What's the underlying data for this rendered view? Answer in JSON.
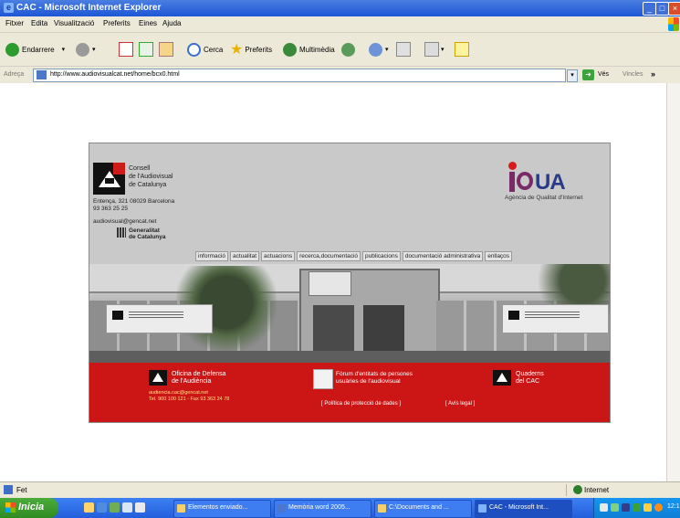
{
  "window": {
    "title": "CAC - Microsoft Internet Explorer",
    "minimize_glyph": "_",
    "maximize_glyph": "□",
    "close_glyph": "×"
  },
  "menu": {
    "items": [
      "Fitxer",
      "Edita",
      "Visualització",
      "Preferits",
      "Eines",
      "Ajuda"
    ]
  },
  "toolbar": {
    "back_label": "Endarrere",
    "search_label": "Cerca",
    "favorites_label": "Preferits",
    "media_label": "Multimèdia"
  },
  "address": {
    "label": "Adreça",
    "url": "http://www.audiovisualcat.net/home/bcx0.html",
    "go_label": "Vés",
    "links_label": "Vincles",
    "links_arrows": "»"
  },
  "status": {
    "text": "Fet",
    "zone": "Internet"
  },
  "taskbar": {
    "start_label": "Inicia",
    "tasks": [
      {
        "label": "Elementos enviado..."
      },
      {
        "label": "Memòria word 2005..."
      },
      {
        "label": "C:\\Documents and ..."
      },
      {
        "label": "CAC - Microsoft Int..."
      }
    ],
    "clock": "12:1"
  },
  "site": {
    "cac_name": "Consell\nde l'Audiovisual\nde Catalunya",
    "address": "Entença, 321 08029 Barcelona",
    "phone": "93 363 25 25",
    "email": "audiovisual@gencat.net",
    "generalitat": "Generalitat\nde Catalunya",
    "iqua_text": "UA",
    "iqua_subtitle": "Agència de Qualitat d'Internet",
    "nav": [
      "informació",
      "actualitat",
      "actuacions",
      "recerca,documentació",
      "publicacions",
      "documentació administrativa",
      "enllaços"
    ],
    "footer": {
      "oficina": "Oficina de Defensa\nde l'Audiència",
      "oficina_email": "audiencia.cac@gencat.net",
      "oficina_phone": "Tel. 900 100 121 - Fax 93 363 24 78",
      "forums": "Fòrum d'entitats de persones\nusuàries de l'audiovisual",
      "quaderns": "Quaderns\ndel CAC",
      "privacy": "[ Política de protecció de dades ]",
      "avis": "[ Avís legal ]"
    }
  }
}
